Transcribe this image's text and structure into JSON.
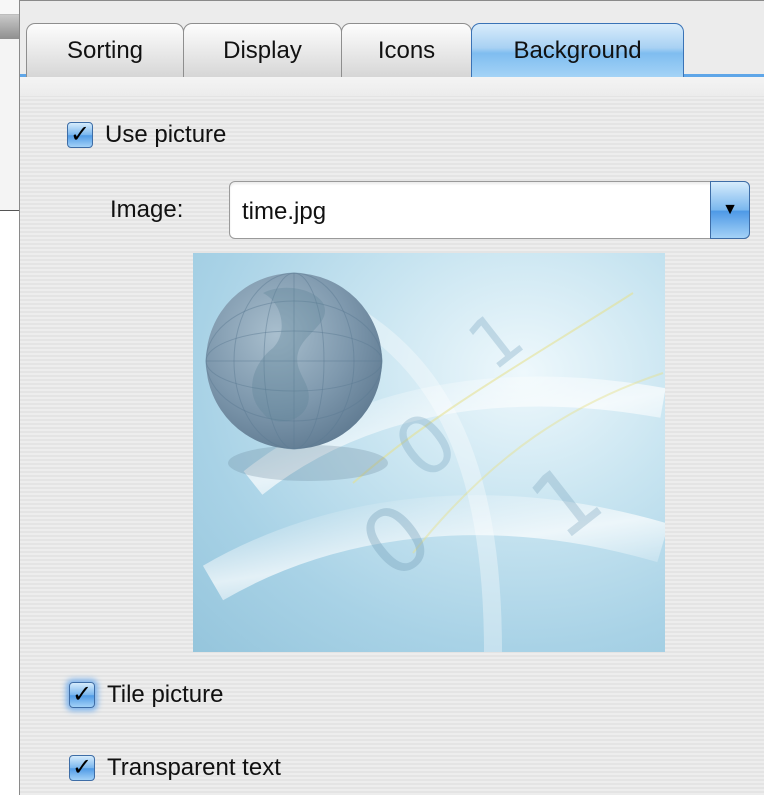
{
  "tabs": [
    {
      "label": "Sorting",
      "active": false
    },
    {
      "label": "Display",
      "active": false
    },
    {
      "label": "Icons",
      "active": false
    },
    {
      "label": "Background",
      "active": true
    }
  ],
  "use_picture": {
    "label": "Use picture",
    "checked": true
  },
  "image_select": {
    "label": "Image:",
    "value": "time.jpg"
  },
  "tile_picture": {
    "label": "Tile picture",
    "checked": true
  },
  "transparent_text": {
    "label": "Transparent text",
    "checked": true
  },
  "icons": {
    "checkmark": "checkmark-icon",
    "dropdown_arrow": "chevron-down-icon"
  },
  "colors": {
    "accent": "#5fa6e8",
    "tab_active": "#8ec6f2"
  }
}
